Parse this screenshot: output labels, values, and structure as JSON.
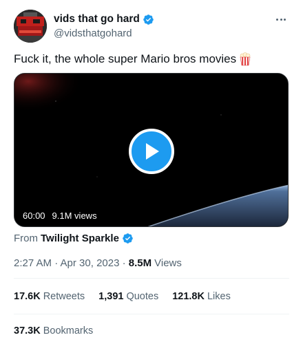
{
  "author": {
    "display_name": "vids that go hard",
    "handle": "@vidsthatgohard",
    "verified": true
  },
  "tweet": {
    "text": "Fuck it, the whole super Mario bros movies",
    "emoji_icon": "popcorn-icon"
  },
  "media": {
    "duration": "60:00",
    "views": "9.1M views"
  },
  "source": {
    "prefix": "From",
    "name": "Twilight Sparkle",
    "verified": true
  },
  "meta": {
    "timestamp": "2:27 AM · Apr 30, 2023 · ",
    "views_count": "8.5M",
    "views_label": "Views"
  },
  "stats": {
    "retweets": {
      "count": "17.6K",
      "label": "Retweets"
    },
    "quotes": {
      "count": "1,391",
      "label": "Quotes"
    },
    "likes": {
      "count": "121.8K",
      "label": "Likes"
    }
  },
  "bookmarks": {
    "count": "37.3K",
    "label": "Bookmarks"
  },
  "colors": {
    "accent": "#1d9bf0",
    "text_primary": "#0f1419",
    "text_secondary": "#536471",
    "divider": "#eff3f4"
  }
}
